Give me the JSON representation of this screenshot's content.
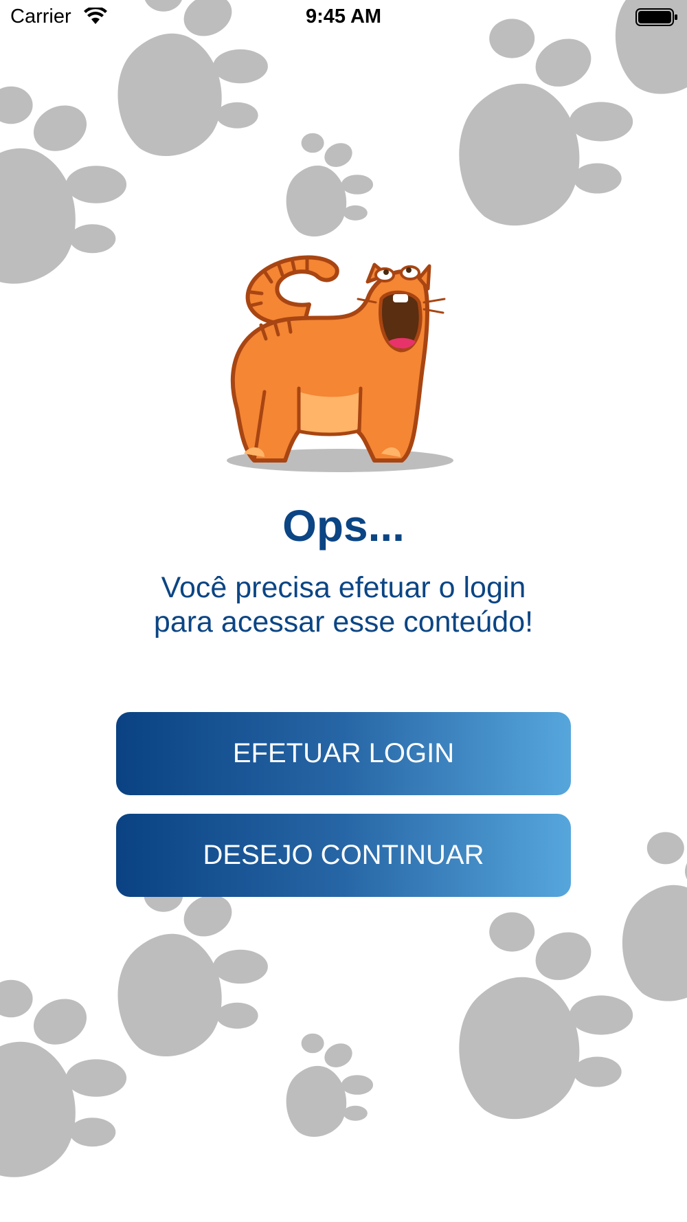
{
  "status_bar": {
    "carrier": "Carrier",
    "time": "9:45 AM",
    "wifi_icon": "wifi-icon",
    "battery_icon": "battery-full-icon"
  },
  "illustration": {
    "icon": "yawning-cat-illustration",
    "background_icon": "paw-print-icon"
  },
  "content": {
    "title": "Ops...",
    "message_line1": "Você precisa efetuar o login",
    "message_line2": "para acessar esse conteúdo!"
  },
  "actions": {
    "login_label": "EFETUAR LOGIN",
    "continue_label": "DESEJO CONTINUAR"
  },
  "colors": {
    "primary_text": "#0b4584",
    "button_gradient_start": "#0a4283",
    "button_gradient_end": "#56a6dc",
    "paw": "#bdbdbd",
    "cat_body": "#f48634"
  }
}
